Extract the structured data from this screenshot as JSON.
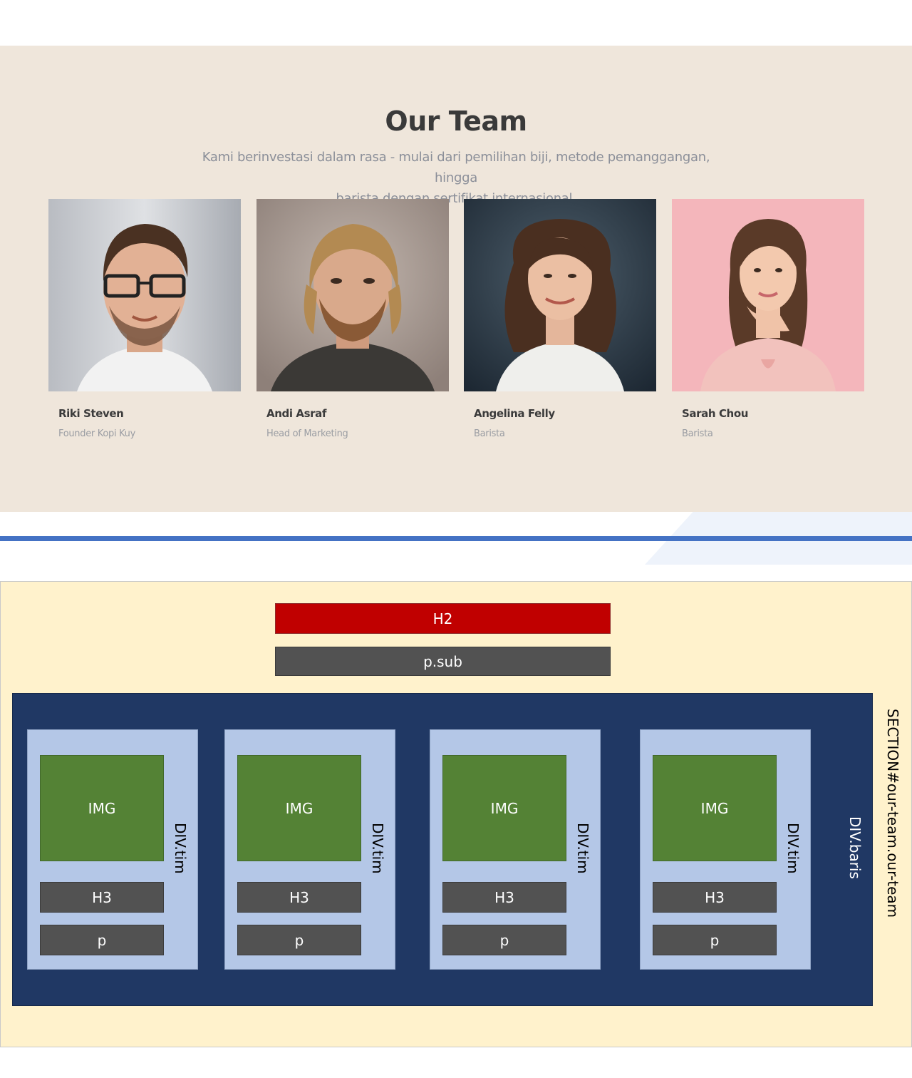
{
  "preview": {
    "title": "Our Team",
    "subtitle_line1": "Kami berinvestasi dalam rasa - mulai dari pemilihan biji, metode pemanggangan, hingga",
    "subtitle_line2": "barista dengan sertifikat internasional.",
    "background_color": "#efe6db",
    "members": [
      {
        "name": "Riki Steven",
        "role": "Founder Kopi Kuy",
        "photo_bg": "#c9ccd1"
      },
      {
        "name": "Andi Asraf",
        "role": "Head of Marketing",
        "photo_bg": "#a89a92"
      },
      {
        "name": "Angelina Felly",
        "role": "Barista",
        "photo_bg": "#2f3f4d"
      },
      {
        "name": "Sarah Chou",
        "role": "Barista",
        "photo_bg": "#f4b6bb"
      }
    ]
  },
  "diagram": {
    "h2_label": "H2",
    "psub_label": "p.sub",
    "baris_label": "DIV.baris",
    "section_label": "SECTION#our-team.our-team",
    "tim_label": "DIV.tim",
    "img_label": "IMG",
    "h3_label": "H3",
    "p_label": "p",
    "colors": {
      "section": "#fff2cc",
      "h2": "#c00000",
      "gray": "#525252",
      "baris": "#203864",
      "tim": "#b4c7e7",
      "img": "#548235",
      "divider": "#4472c4"
    },
    "tims": [
      {
        "img": "IMG",
        "h3": "H3",
        "p": "p",
        "label": "DIV.tim"
      },
      {
        "img": "IMG",
        "h3": "H3",
        "p": "p",
        "label": "DIV.tim"
      },
      {
        "img": "IMG",
        "h3": "H3",
        "p": "p",
        "label": "DIV.tim"
      },
      {
        "img": "IMG",
        "h3": "H3",
        "p": "p",
        "label": "DIV.tim"
      }
    ]
  }
}
